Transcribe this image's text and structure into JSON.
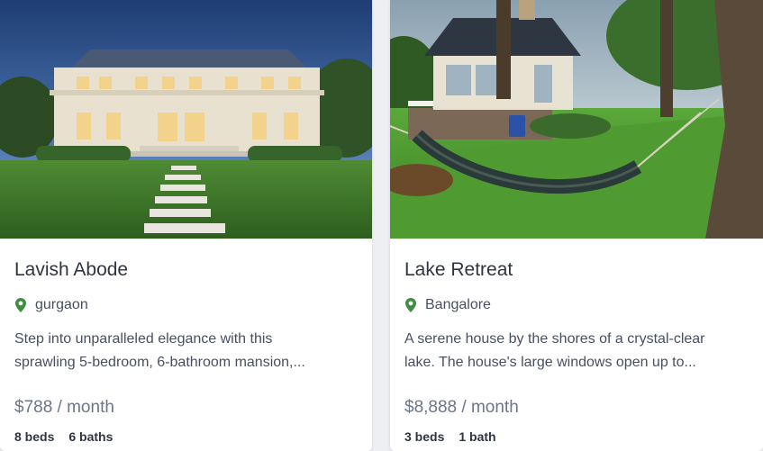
{
  "listings": [
    {
      "title": "Lavish Abode",
      "location": "gurgaon",
      "description_line1": "Step into unparalleled elegance with this",
      "description_line2": "sprawling 5-bedroom, 6-bathroom mansion,...",
      "price": "$788 / month",
      "beds": "8 beds",
      "baths": "6 baths",
      "photo_icon": "mansion-photo"
    },
    {
      "title": "Lake Retreat",
      "location": "Bangalore",
      "description_line1": "A serene house by the shores of a crystal-clear",
      "description_line2": "lake. The house's large windows open up to...",
      "price": "$8,888 / month",
      "beds": "3 beds",
      "baths": "1 bath",
      "photo_icon": "lake-house-photo"
    }
  ],
  "colors": {
    "pin": "#3e8e41",
    "title": "#2f3540",
    "price": "#6b7689"
  }
}
